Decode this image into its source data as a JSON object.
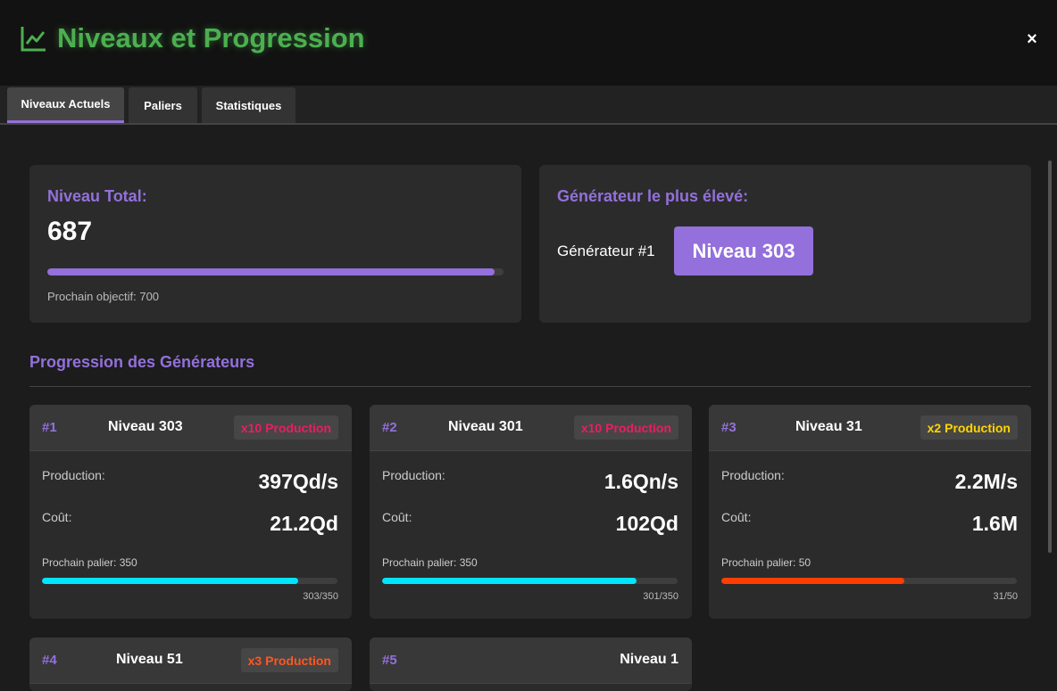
{
  "header": {
    "title": "Niveaux et Progression",
    "icon": "chart-line-icon",
    "close_label": "×",
    "accent": "#4caf50"
  },
  "tabs": [
    {
      "label": "Niveaux Actuels",
      "active": true
    },
    {
      "label": "Paliers",
      "active": false
    },
    {
      "label": "Statistiques",
      "active": false
    }
  ],
  "total": {
    "title": "Niveau Total:",
    "value": "687",
    "progress": 0.981,
    "next_goal": "Prochain objectif: 700"
  },
  "highest": {
    "title": "Générateur le plus élevé:",
    "generator": "Générateur #1",
    "level": "Niveau 303"
  },
  "section": {
    "title": "Progression des Générateurs"
  },
  "generators": [
    {
      "id": "#1",
      "level": "Niveau 303",
      "badge": "x10 Production",
      "badge_color": "#e91e63",
      "production_label": "Production:",
      "production": "397Qd/s",
      "cost_label": "Coût:",
      "cost": "21.2Qd",
      "next": "Prochain palier: 350",
      "progress": 0.866,
      "fraction": "303/350",
      "bar_color": "#00e5ff"
    },
    {
      "id": "#2",
      "level": "Niveau 301",
      "badge": "x10 Production",
      "badge_color": "#e91e63",
      "production_label": "Production:",
      "production": "1.6Qn/s",
      "cost_label": "Coût:",
      "cost": "102Qd",
      "next": "Prochain palier: 350",
      "progress": 0.86,
      "fraction": "301/350",
      "bar_color": "#00e5ff"
    },
    {
      "id": "#3",
      "level": "Niveau 31",
      "badge": "x2 Production",
      "badge_color": "#ffd600",
      "production_label": "Production:",
      "production": "2.2M/s",
      "cost_label": "Coût:",
      "cost": "1.6M",
      "next": "Prochain palier: 50",
      "progress": 0.62,
      "fraction": "31/50",
      "bar_color": "#ff3d00"
    },
    {
      "id": "#4",
      "level": "Niveau 51",
      "badge": "x3 Production",
      "badge_color": "#ff5722"
    },
    {
      "id": "#5",
      "level": "Niveau 1"
    }
  ]
}
